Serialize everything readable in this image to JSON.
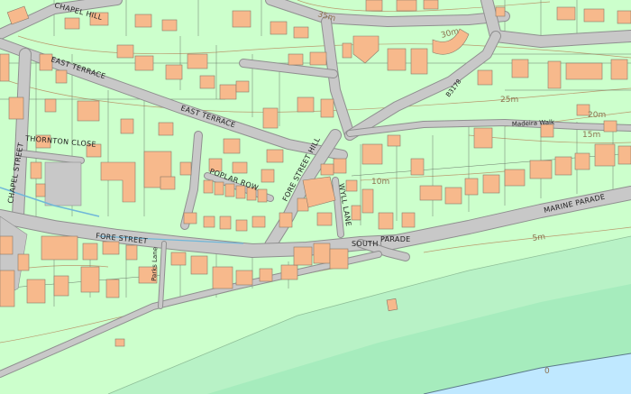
{
  "colors": {
    "land": "#ccffcc",
    "foreshore": "#b3f0c4",
    "sea_band": "#a8eec2",
    "water": "#bfe8ff",
    "building": "#f7b98c",
    "road": "#c8c8c8",
    "contour": "#b99a6e"
  },
  "labels": {
    "chapel_hill": "CHAPEL HILL",
    "east_terrace_w": "EAST TERRACE",
    "east_terrace_e": "EAST TERRACE",
    "thornton_close": "THORNTON CLOSE",
    "chapel_street": "CHAPEL STREET",
    "poplar_row": "POPLAR ROW",
    "fore_street_hill": "FORE STREET HILL",
    "fore_street": "FORE STREET",
    "wyll_lane": "WYLL LANE",
    "south_parade": "SOUTH",
    "parade": "PARADE",
    "marine_parade": "MARINE PARADE",
    "madeira_walk": "Madeira Walk",
    "b3178": "B3178",
    "parks_lane": "Parks Lane"
  },
  "elevations": {
    "e35": "35m",
    "e30": "30m",
    "e25": "25m",
    "e20": "20m",
    "e15": "15m",
    "e10": "10m",
    "e5": "5m",
    "e0": "0"
  }
}
